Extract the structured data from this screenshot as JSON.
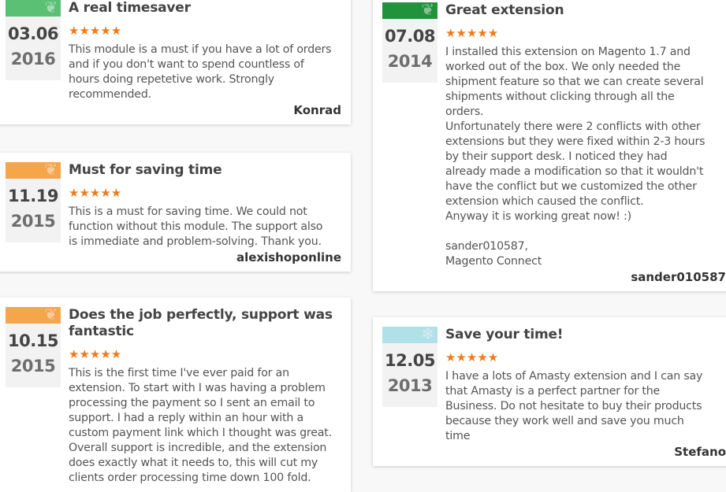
{
  "star_color": "#f07a1a",
  "reviews": [
    {
      "column": "left",
      "title": "A real timesaver",
      "date": "03.06",
      "year": "2016",
      "rating": 5,
      "band_color": "#5bbf74",
      "band_icon": "leaf-icon",
      "body": [
        "This module is a must if you have a lot of orders",
        "and if you don't want to spend countless of",
        "hours doing repetetive work. Strongly",
        "recommended."
      ],
      "author": "Konrad"
    },
    {
      "column": "left",
      "title": "Must for saving time",
      "date": "11.19",
      "year": "2015",
      "rating": 5,
      "band_color": "#f5a54a",
      "band_icon": "leaf-icon",
      "body": [
        "This is a must for saving time. We could not",
        "function without this module. The support also",
        "is immediate and problem-solving. Thank you."
      ],
      "author": "alexishoponline"
    },
    {
      "column": "left",
      "title": "Does the job perfectly, support was fantastic",
      "date": "10.15",
      "year": "2015",
      "rating": 5,
      "band_color": "#f5a54a",
      "band_icon": "leaf-icon",
      "body": [
        "This is the first time I've ever paid for an",
        "extension. To start with I was having a problem",
        "processing the payment so I sent an email to",
        "support. I had a reply within an hour with a",
        "custom payment link which I thought was great.",
        "Overall support is incredible, and the extension",
        "does exactly what it needs to, this will cut my",
        "clients order processing time down 100 fold."
      ],
      "author": ""
    },
    {
      "column": "right",
      "title": "Great extension",
      "date": "07.08",
      "year": "2014",
      "rating": 5,
      "band_color": "#23923c",
      "band_icon": "leaf-icon",
      "body": [
        "I installed this extension on Magento 1.7 and",
        "worked out of the box. We only needed the",
        "shipment feature so that we can create several",
        "shipments without clicking through all the",
        "orders.",
        "Unfortunately there were 2 conflicts with other",
        "extensions but they were fixed within 2-3 hours",
        "by their support desk. I noticed they had",
        "already made a modification so that it wouldn't",
        "have the conflict but we customized the other",
        "extension which caused the conflict.",
        "Anyway it is working great now! :)",
        "",
        "sander010587,",
        "Magento Connect"
      ],
      "author": "sander010587"
    },
    {
      "column": "right",
      "title": "Save your time!",
      "date": "12.05",
      "year": "2013",
      "rating": 5,
      "band_color": "#b0e0e8",
      "band_icon": "snowflake-icon",
      "body": [
        "I have a lots of Amasty extension and I can say",
        "that Amasty is a perfect partner for the",
        "Business. Do not hesitate to buy their products",
        "because they work well and save you much",
        "time"
      ],
      "author": "Stefano"
    }
  ]
}
